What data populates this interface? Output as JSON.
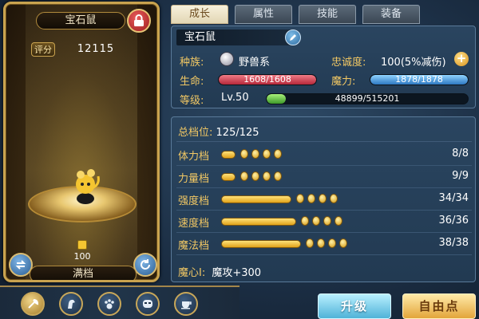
{
  "portrait": {
    "name": "宝石鼠",
    "score_label": "评分",
    "score_value": "12115",
    "grade_value": "100",
    "status_label": "满档"
  },
  "tabs": [
    {
      "label": "成长",
      "active": true
    },
    {
      "label": "属性",
      "active": false
    },
    {
      "label": "技能",
      "active": false
    },
    {
      "label": "装备",
      "active": false
    }
  ],
  "info": {
    "pet_name": "宝石鼠",
    "race_label": "种族:",
    "race_value": "野兽系",
    "loyalty_label": "忠诚度:",
    "loyalty_value": "100(5%减伤)",
    "hp_label": "生命:",
    "hp_text": "1608/1608",
    "hp_fraction": 1.0,
    "mp_label": "魔力:",
    "mp_text": "1878/1878",
    "mp_fraction": 1.0,
    "level_label": "等级:",
    "level_value": "Lv.50",
    "xp_text": "48899/515201",
    "xp_fraction": 0.095
  },
  "stats": {
    "total_label": "总档位:",
    "total_value": "125/125",
    "rows": [
      {
        "label": "体力档",
        "value": "8/8"
      },
      {
        "label": "力量档",
        "value": "9/9"
      },
      {
        "label": "强度档",
        "value": "34/34"
      },
      {
        "label": "速度档",
        "value": "36/36"
      },
      {
        "label": "魔法档",
        "value": "38/38"
      }
    ],
    "heart_label": "魔心I:",
    "heart_value": "魔攻+300"
  },
  "buttons": {
    "upgrade": "升级",
    "free_points": "自由点"
  },
  "colors": {
    "accent_gold": "#f2c864",
    "hp_red": "#d8394b",
    "mp_blue": "#4b9ce0",
    "xp_green": "#5bbf3a"
  }
}
